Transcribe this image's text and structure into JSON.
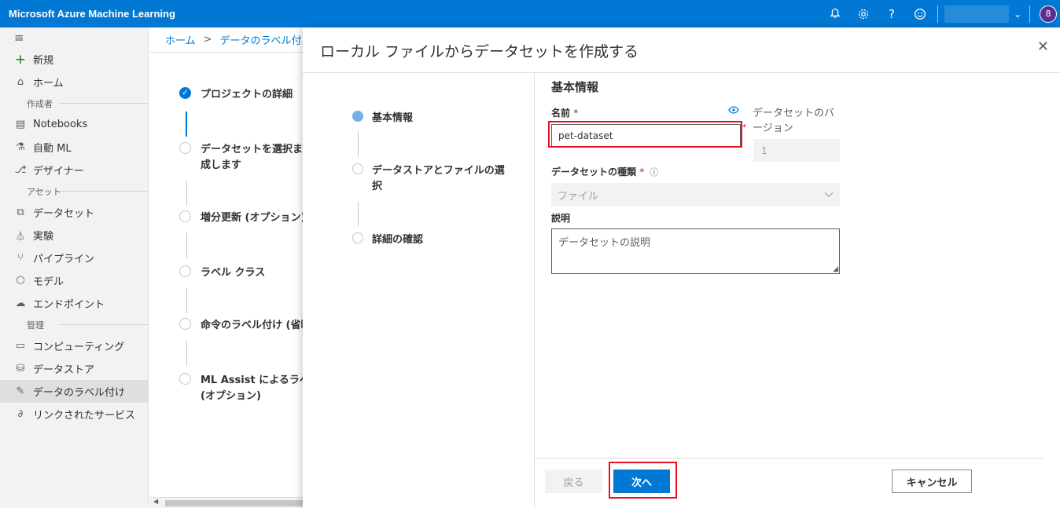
{
  "app": {
    "title": "Microsoft Azure Machine Learning"
  },
  "topbar": {
    "icons": [
      "bell-icon",
      "gear-icon",
      "help-icon",
      "smiley-icon"
    ],
    "help_glyph": "?",
    "avatar_glyph": "8",
    "chevron": "⌄"
  },
  "sidebar": {
    "hamburger": "≡",
    "new_label": "新規",
    "home_label": "ホーム",
    "section_author": "作成者",
    "items_author": [
      "Notebooks",
      "自動 ML",
      "デザイナー"
    ],
    "section_assets": "アセット",
    "items_assets": [
      "データセット",
      "実験",
      "パイプライン",
      "モデル",
      "エンドポイント"
    ],
    "section_manage": "管理",
    "items_manage": [
      "コンピューティング",
      "データストア",
      "データのラベル付け",
      "リンクされたサービス"
    ],
    "active_item": "データのラベル付け"
  },
  "background": {
    "breadcrumb": [
      "ホーム",
      "データのラベル付け"
    ],
    "steps": [
      "プロジェクトの詳細",
      "データセットを選択ま",
      "成します",
      "増分更新 (オプション)",
      "ラベル クラス",
      "命令のラベル付け (省略",
      "ML Assist によるラベル",
      "(オプション)"
    ]
  },
  "dialog": {
    "title": "ローカル ファイルからデータセットを作成する",
    "close": "✕",
    "wizard_steps": [
      "基本情報",
      "データストアとファイルの選",
      "択",
      "詳細の確認"
    ],
    "form_heading": "基本情報",
    "name_label": "名前",
    "required_mark": "*",
    "name_value": "pet-dataset",
    "version_label_line1": "データセットのバ",
    "version_label_line2": "ージョン",
    "version_value": "1",
    "type_label": "データセットの種類",
    "type_value": "ファイル",
    "description_label": "説明",
    "description_placeholder": "データセットの説明",
    "back_button": "戻る",
    "next_button": "次へ",
    "cancel_button": "キャンセル"
  },
  "colors": {
    "accent": "#0078d4",
    "highlight": "#e81123"
  }
}
